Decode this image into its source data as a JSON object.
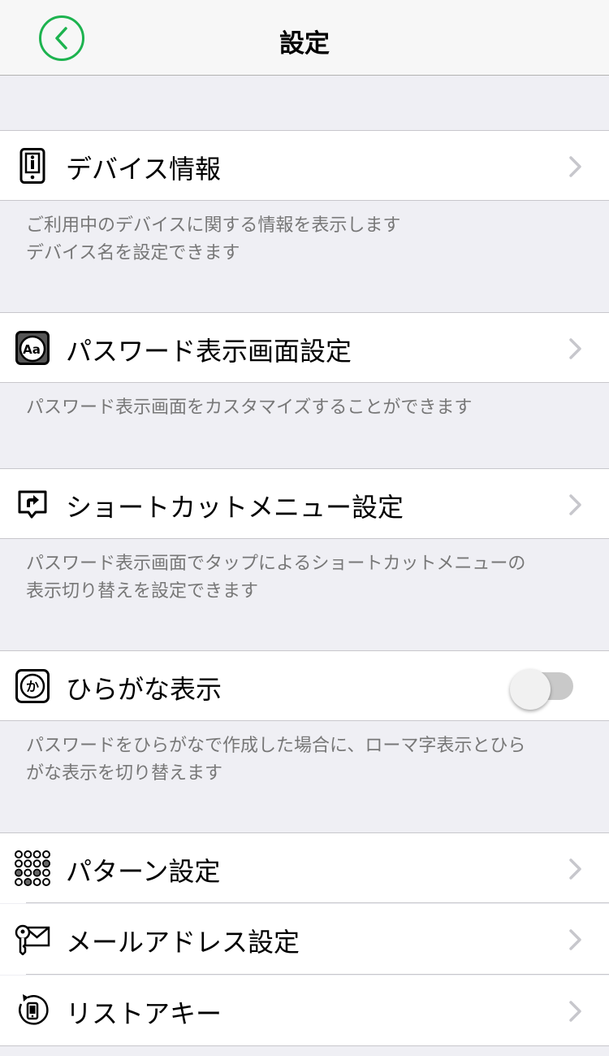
{
  "nav": {
    "title": "設定"
  },
  "rows": [
    {
      "label": "デバイス情報",
      "desc1": "ご利用中のデバイスに関する情報を表示します",
      "desc2": "デバイス名を設定できます"
    },
    {
      "label": "パスワード表示画面設定",
      "desc1": "パスワード表示画面をカスタマイズすることができます"
    },
    {
      "label": "ショートカットメニュー設定",
      "desc1": "パスワード表示画面でタップによるショートカットメニューの",
      "desc2": "表示切り替えを設定できます"
    },
    {
      "label": "ひらがな表示",
      "toggle_on": false,
      "icon_text": "か",
      "desc1": "パスワードをひらがなで作成した場合に、ローマ字表示とひら",
      "desc2": "がな表示を切り替えます"
    },
    {
      "label": "パターン設定"
    },
    {
      "label": "メールアドレス設定"
    },
    {
      "label": "リストアキー"
    }
  ],
  "icons": {
    "device_info": "info-icon",
    "password_view": "font-icon",
    "shortcut": "shortcut-icon",
    "hiragana": "hiragana-icon",
    "pattern": "pattern-grid-icon",
    "mail": "mail-key-icon",
    "restore": "restore-key-icon"
  },
  "colors": {
    "accent": "#1db34f",
    "toggle_off": "#c9c9c9",
    "background": "#efeff4"
  }
}
